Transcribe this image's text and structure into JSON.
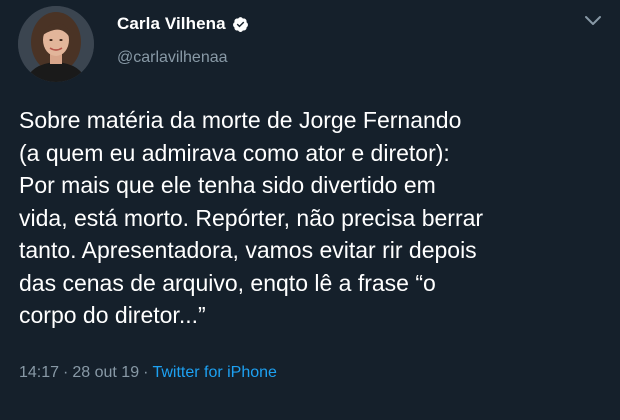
{
  "author": {
    "display_name": "Carla Vilhena",
    "handle": "@carlavilhenaa",
    "verified": true
  },
  "tweet": {
    "text": "Sobre matéria da morte de Jorge Fernando\n(a quem eu admirava como ator e diretor):\nPor mais que ele tenha sido divertido em\nvida, está morto. Repórter, não precisa berrar\ntanto. Apresentadora, vamos evitar rir depois\ndas cenas de arquivo, enqto lê a frase “o\ncorpo do diretor...”",
    "time": "14:17",
    "date": "28 out 19",
    "separator": "·",
    "source": "Twitter for iPhone"
  },
  "icons": {
    "verified": "verified-badge-icon",
    "menu": "chevron-down-icon"
  },
  "colors": {
    "background": "#15202b",
    "secondary_text": "#8899a6",
    "link": "#1da1f2",
    "verified_badge": "#ffffff"
  }
}
